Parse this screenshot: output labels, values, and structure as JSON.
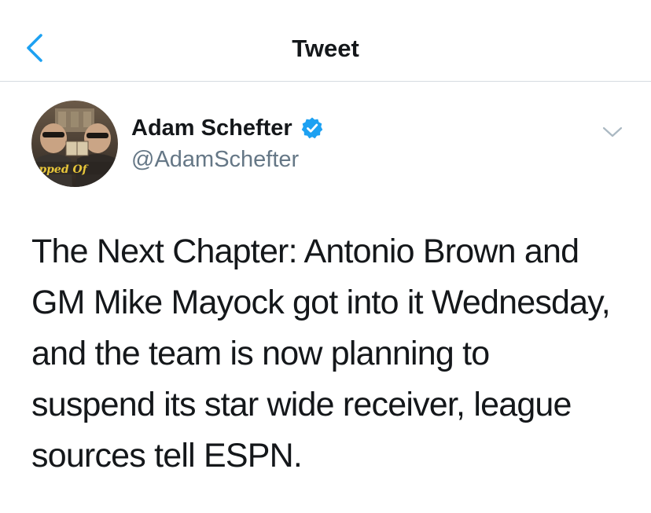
{
  "header": {
    "title": "Tweet",
    "back_icon": "chevron-left-icon",
    "accent_color": "#1da1f2"
  },
  "author": {
    "name": "Adam Schefter",
    "handle": "@AdamSchefter",
    "verified": true,
    "verified_icon": "verified-badge-icon",
    "avatar_caption": "Topped Off",
    "more_icon": "chevron-down-icon"
  },
  "tweet": {
    "lines": [
      "The Next Chapter: Antonio Brown and",
      "GM Mike Mayock got into it Wednesday,",
      "and the team is now planning to",
      "suspend its star wide receiver, league",
      "sources tell ESPN."
    ]
  },
  "colors": {
    "text": "#14171a",
    "secondary_text": "#657786",
    "divider": "#d6dbe0",
    "verified_blue": "#1da1f2"
  }
}
